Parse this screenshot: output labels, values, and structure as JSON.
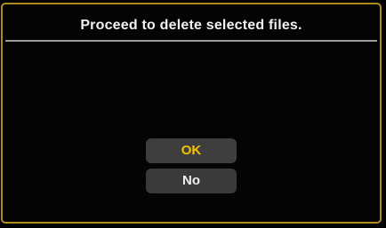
{
  "dialog": {
    "title": "Proceed to delete selected files.",
    "buttons": {
      "ok_label": "OK",
      "no_label": "No"
    },
    "selected": "OK"
  },
  "colors": {
    "frame_border": "#b38a20",
    "selected_text": "#f5c400",
    "button_bg": "#3a3a3a",
    "text": "#f0f0f0"
  }
}
